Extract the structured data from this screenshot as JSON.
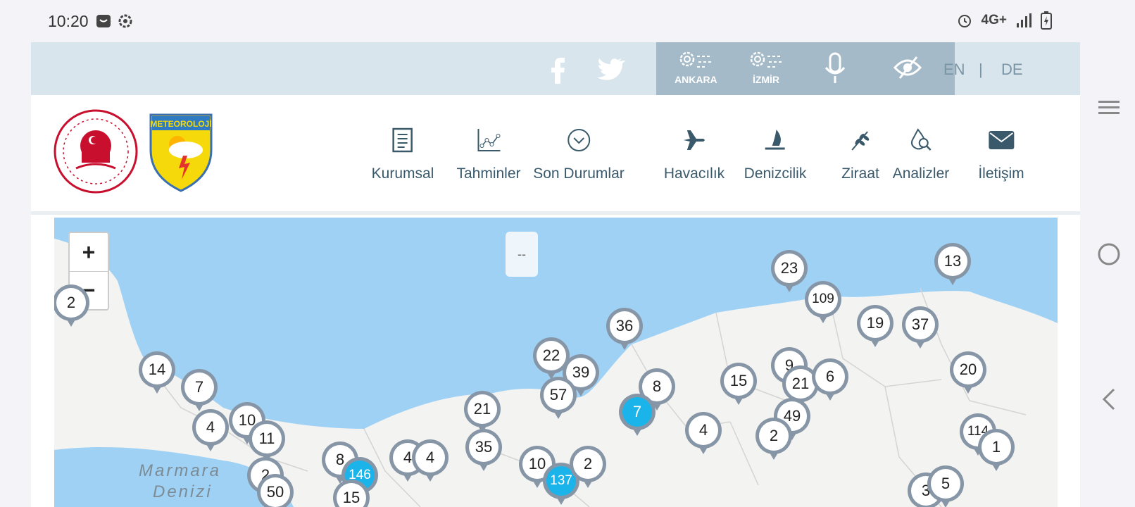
{
  "status_bar": {
    "time": "10:20",
    "network": "4G+"
  },
  "top_strip": {
    "weather_ankara": "ANKARA",
    "weather_izmir": "İZMİR",
    "lang_en": "EN",
    "lang_sep": "|",
    "lang_de": "DE"
  },
  "menu": {
    "items": [
      {
        "label": "Kurumsal",
        "icon": "document-icon"
      },
      {
        "label": "Tahminler",
        "icon": "chart-icon"
      },
      {
        "label": "Son Durumlar",
        "icon": "chevron-circle-icon"
      },
      {
        "label": "Havacılık",
        "icon": "airplane-icon"
      },
      {
        "label": "Denizcilik",
        "icon": "sailboat-icon"
      },
      {
        "label": "Ziraat",
        "icon": "wheat-icon"
      },
      {
        "label": "Analizler",
        "icon": "drop-search-icon"
      },
      {
        "label": "İletişim",
        "icon": "envelope-icon"
      }
    ]
  },
  "logo": {
    "text": "METEOROLOJİ"
  },
  "map": {
    "zoom_in": "+",
    "zoom_out": "−",
    "overlay_text": "--",
    "labels": [
      "Marmara",
      "Denizi"
    ],
    "markers": [
      {
        "v": "2"
      },
      {
        "v": "14"
      },
      {
        "v": "7"
      },
      {
        "v": "4"
      },
      {
        "v": "10"
      },
      {
        "v": "11"
      },
      {
        "v": "2"
      },
      {
        "v": "50"
      },
      {
        "v": "8"
      },
      {
        "v": "146",
        "blue": true
      },
      {
        "v": "15"
      },
      {
        "v": "4"
      },
      {
        "v": "4"
      },
      {
        "v": "21"
      },
      {
        "v": "35"
      },
      {
        "v": "10"
      },
      {
        "v": "137",
        "blue": true
      },
      {
        "v": "2"
      },
      {
        "v": "22"
      },
      {
        "v": "39"
      },
      {
        "v": "57"
      },
      {
        "v": "36"
      },
      {
        "v": "8"
      },
      {
        "v": "7",
        "blue": true
      },
      {
        "v": "4"
      },
      {
        "v": "15"
      },
      {
        "v": "23"
      },
      {
        "v": "109"
      },
      {
        "v": "9"
      },
      {
        "v": "21"
      },
      {
        "v": "6"
      },
      {
        "v": "49"
      },
      {
        "v": "2"
      },
      {
        "v": "19"
      },
      {
        "v": "37"
      },
      {
        "v": "13"
      },
      {
        "v": "20"
      },
      {
        "v": "114"
      },
      {
        "v": "1"
      },
      {
        "v": "3"
      },
      {
        "v": "5"
      }
    ]
  }
}
